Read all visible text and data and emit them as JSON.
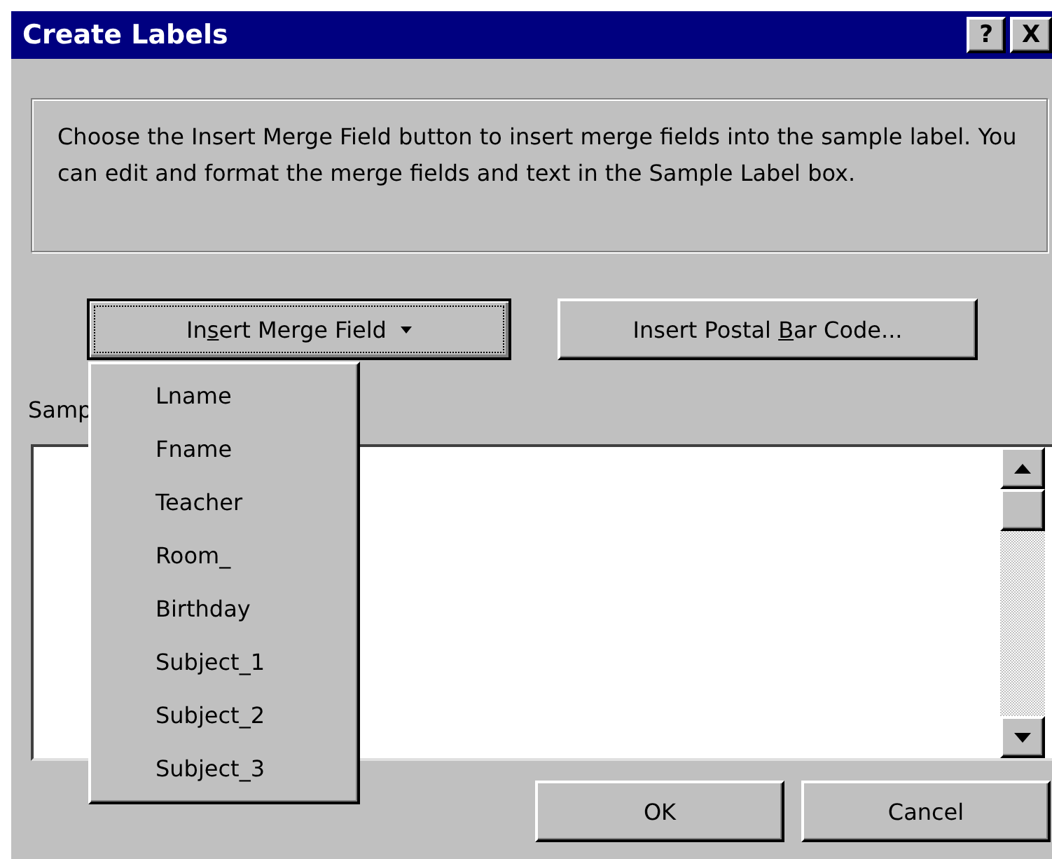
{
  "window": {
    "title": "Create Labels",
    "title_buttons": [
      {
        "kind": "help",
        "label": "?"
      },
      {
        "kind": "close",
        "label": "X"
      }
    ]
  },
  "instructions": "Choose the Insert Merge Field button to insert merge fields into the sample label.  You can edit and format the merge fields and text in the Sample Label box.",
  "buttons": [
    {
      "kind": "dropdown",
      "before": "In",
      "access_key": "s",
      "after": "ert Merge Field",
      "focused": true
    },
    {
      "kind": "plain",
      "before": "Insert Postal ",
      "access_key": "B",
      "after": "ar Code...",
      "focused": false
    }
  ],
  "sample_label": {
    "label": "Samp"
  },
  "menu": {
    "items": [
      "Lname",
      "Fname",
      "Teacher",
      "Room_",
      "Birthday",
      "Subject_1",
      "Subject_2",
      "Subject_3"
    ]
  },
  "footer_buttons": [
    "OK",
    "Cancel"
  ]
}
